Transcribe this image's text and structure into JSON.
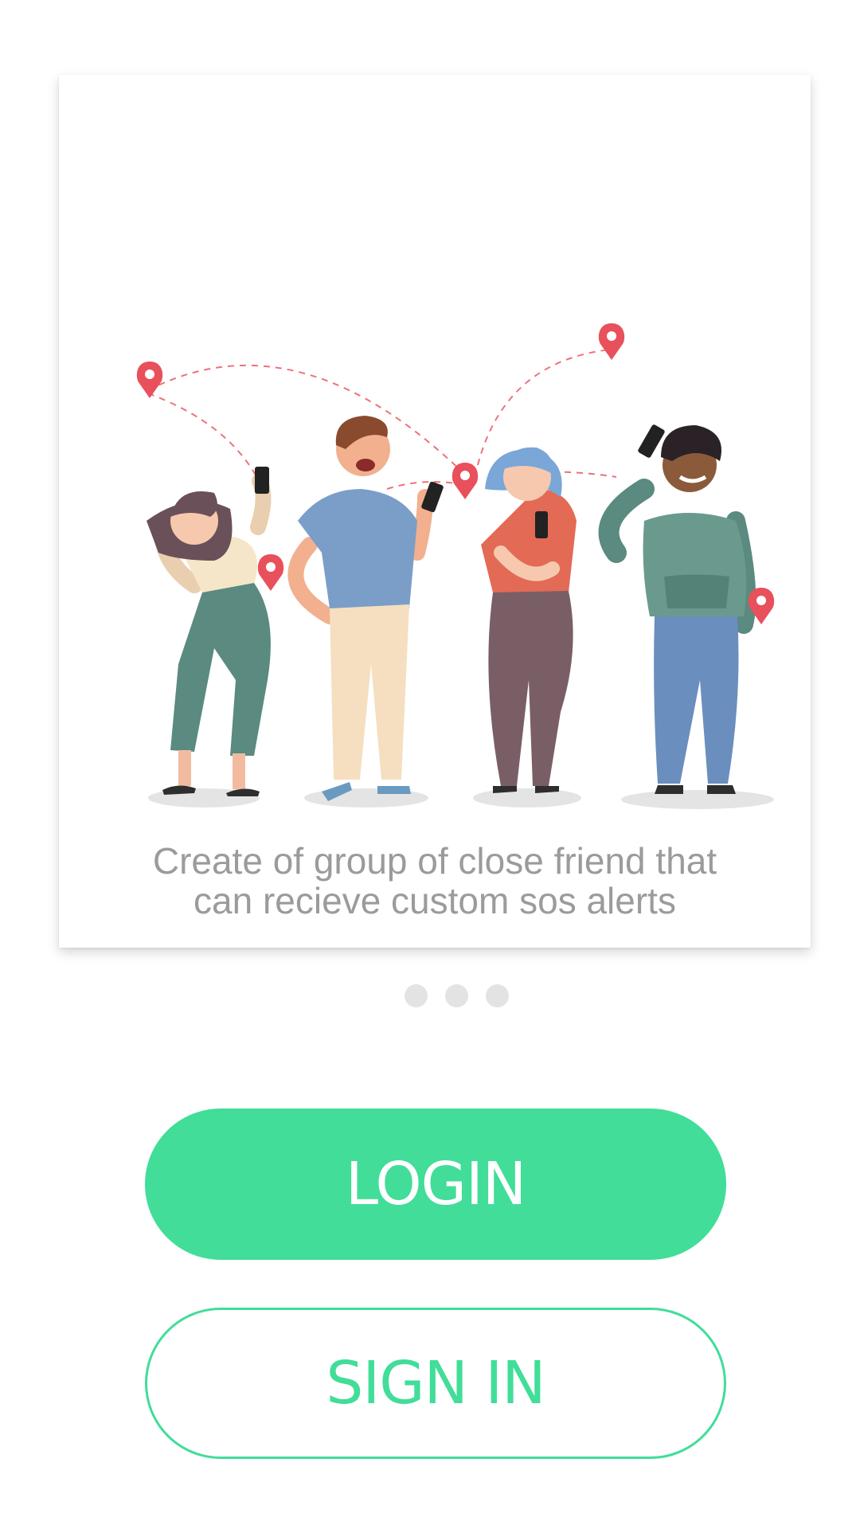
{
  "onboarding": {
    "caption_line1": "Create of group of close friend that",
    "caption_line2": "can recieve custom sos alerts",
    "illustration_icon": "friends-with-location-pins-illustration",
    "pager": {
      "count": 3
    }
  },
  "actions": {
    "login_label": "LOGIN",
    "signin_label": "SIGN IN"
  },
  "colors": {
    "accent": "#41dd99",
    "pin": "#e8505b",
    "caption": "#9b9b9b",
    "dot_inactive": "#e3e3e3"
  }
}
